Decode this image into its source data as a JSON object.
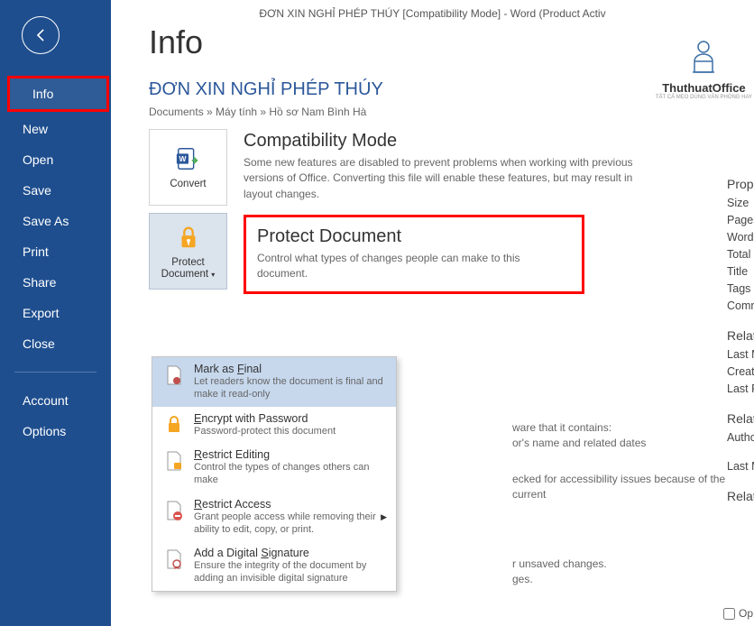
{
  "title_bar": "ĐƠN XIN NGHỈ PHÉP THÚY [Compatibility Mode] - Word (Product Activ",
  "sidebar": {
    "items": [
      "Info",
      "New",
      "Open",
      "Save",
      "Save As",
      "Print",
      "Share",
      "Export",
      "Close"
    ],
    "bottom": [
      "Account",
      "Options"
    ]
  },
  "page_title": "Info",
  "doc_title": "ĐƠN XIN NGHỈ PHÉP THÚY",
  "breadcrumb": "Documents » Máy tính » Hồ sơ Nam Bình Hà",
  "compat": {
    "tile_label": "Convert",
    "heading": "Compatibility Mode",
    "desc": "Some new features are disabled to prevent problems when working with previous versions of Office. Converting this file will enable these features, but may result in layout changes."
  },
  "protect": {
    "tile_label": "Protect Document",
    "heading": "Protect Document",
    "desc": "Control what types of changes people can make to this document."
  },
  "dropdown": [
    {
      "title": "Mark as Final",
      "desc": "Let readers know the document is final and make it read-only"
    },
    {
      "title": "Encrypt with Password",
      "desc": "Password-protect this document"
    },
    {
      "title": "Restrict Editing",
      "desc": "Control the types of changes others can make"
    },
    {
      "title": "Restrict Access",
      "desc": "Grant people access while removing their ability to edit, copy, or print."
    },
    {
      "title": "Add a Digital Signature",
      "desc": "Ensure the integrity of the document by adding an invisible digital signature"
    }
  ],
  "bg_fragments": {
    "t1": "ware that it contains:",
    "t2": "or's name and related dates",
    "t3": "ecked for accessibility issues because of the current",
    "t4": "r unsaved changes.",
    "t5": "ges."
  },
  "props": {
    "heading1": "Prope",
    "items1": [
      "Size",
      "Pages",
      "Words",
      "Total E",
      "Title",
      "Tags",
      "Comm"
    ],
    "heading2": "Relat",
    "items2": [
      "Last M",
      "Create",
      "Last Pr"
    ],
    "heading3": "Relat",
    "items3": [
      "Autho"
    ],
    "items4": [
      "Last M"
    ],
    "heading4": "Relat"
  },
  "logo": {
    "brand": "ThuthuatOffice",
    "tag": "TẤT CẢ MẸO DÙNG VĂN PHÒNG HAY"
  },
  "checkbox_label": "Op"
}
